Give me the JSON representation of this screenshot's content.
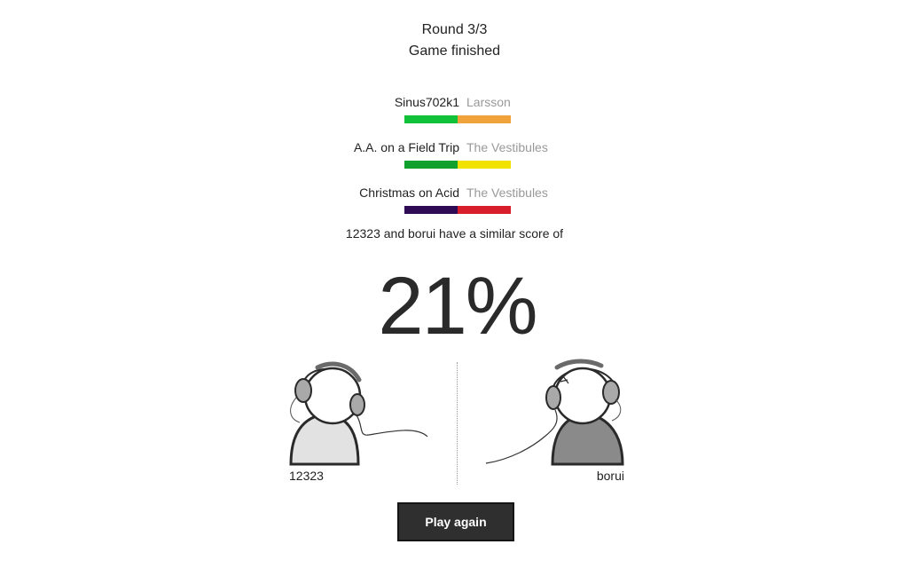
{
  "header": {
    "round": "Round 3/3",
    "status": "Game finished"
  },
  "tracks": [
    {
      "song": "Sinus702k1",
      "artist": "Larsson",
      "left_color": "#11c13a",
      "right_color": "#f0a33a"
    },
    {
      "song": "A.A. on a Field Trip",
      "artist": "The Vestibules",
      "left_color": "#10a02e",
      "right_color": "#f2e200"
    },
    {
      "song": "Christmas on Acid",
      "artist": "The Vestibules",
      "left_color": "#2f0a55",
      "right_color": "#d81e2b"
    }
  ],
  "similarity": {
    "text": "12323 and borui have a similar score of",
    "score": "21%"
  },
  "players": {
    "left": {
      "name": "12323",
      "shirt_color": "#e2e2e2"
    },
    "right": {
      "name": "borui",
      "shirt_color": "#8a8a8a"
    }
  },
  "actions": {
    "play_again": "Play again"
  }
}
